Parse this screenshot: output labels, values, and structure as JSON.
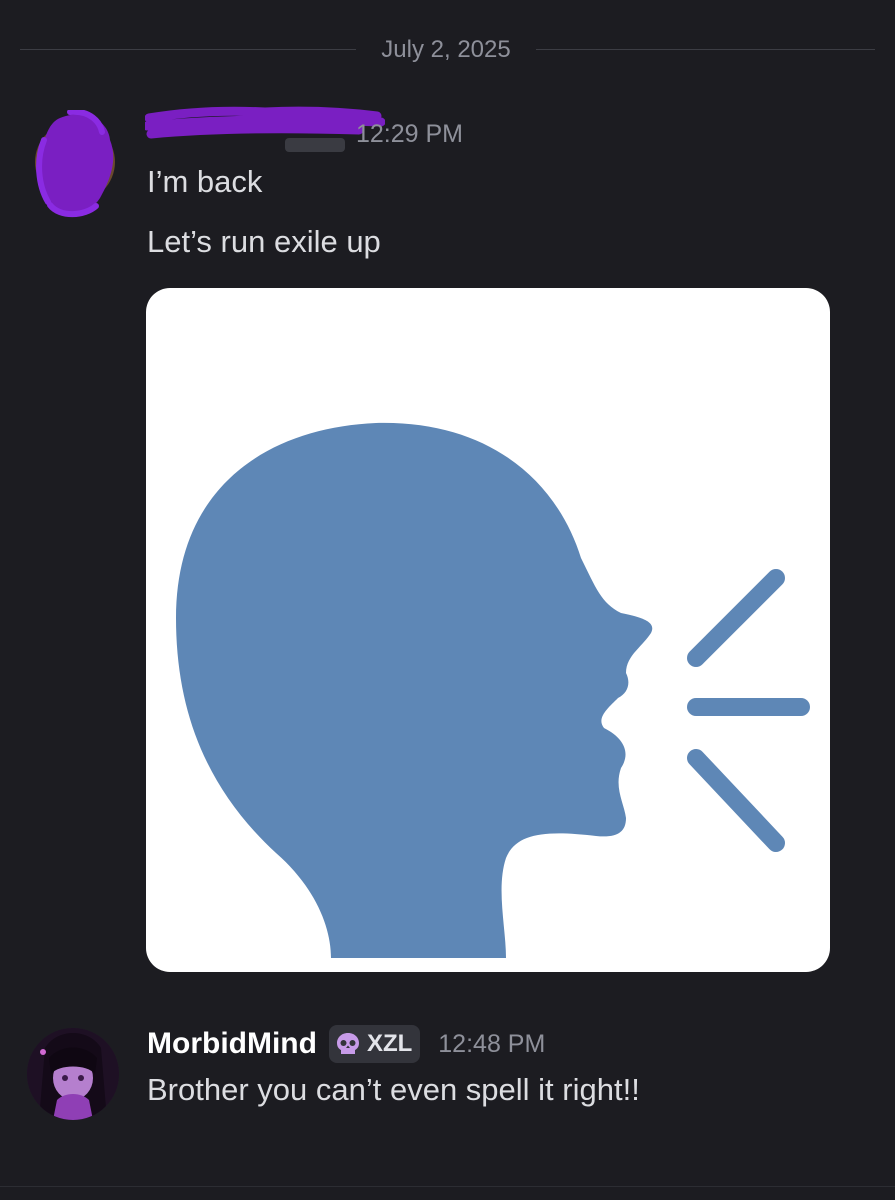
{
  "divider": {
    "date": "July 2, 2025"
  },
  "message1": {
    "time": "12:29 PM",
    "lines": [
      "I’m back",
      "Let’s run exile up"
    ],
    "attachment_icon": "speaking-head-icon"
  },
  "message2": {
    "username": "MorbidMind",
    "tag_icon": "skull-icon",
    "tag": "XZL",
    "time": "12:48 PM",
    "text": "Brother you can’t even spell it right!!"
  },
  "colors": {
    "background": "#1c1c21",
    "text": "#dcdde1",
    "muted": "#8e909a",
    "redaction": "#7a1fc2",
    "emoji_blue": "#5e87b6"
  }
}
